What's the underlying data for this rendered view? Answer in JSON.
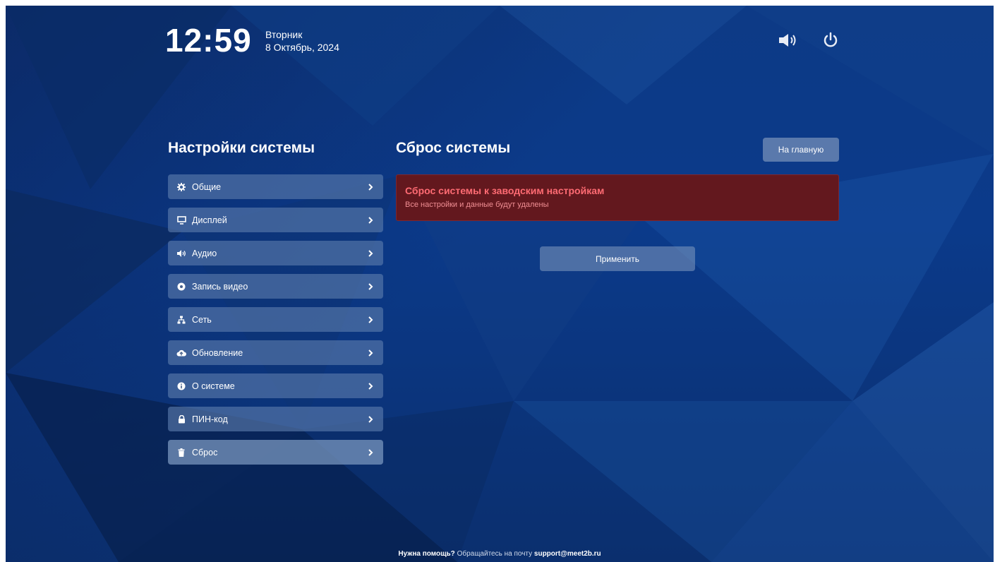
{
  "header": {
    "time": "12:59",
    "weekday": "Вторник",
    "date": "8 Октябрь, 2024",
    "icons": [
      "volume-icon",
      "power-icon"
    ]
  },
  "sidebar": {
    "title": "Настройки системы",
    "items": [
      {
        "label": "Общие",
        "icon": "gear-icon"
      },
      {
        "label": "Дисплей",
        "icon": "monitor-icon"
      },
      {
        "label": "Аудио",
        "icon": "volume-icon"
      },
      {
        "label": "Запись видео",
        "icon": "record-icon"
      },
      {
        "label": "Сеть",
        "icon": "network-icon"
      },
      {
        "label": "Обновление",
        "icon": "cloud-upload-icon"
      },
      {
        "label": "О системе",
        "icon": "info-icon"
      },
      {
        "label": "ПИН-код",
        "icon": "lock-icon"
      },
      {
        "label": "Сброс",
        "icon": "trash-icon"
      }
    ],
    "active_index": 8
  },
  "main": {
    "title": "Сброс системы",
    "home_label": "На главную",
    "warning": {
      "title": "Сброс системы к заводским настройкам",
      "text": "Все настройки и данные будут удалены"
    },
    "apply_label": "Применить"
  },
  "footer": {
    "help_bold": "Нужна помощь?",
    "help_text": "Обращайтесь на почту",
    "email": "support@meet2b.ru"
  },
  "colors": {
    "background": "#0b3a8a",
    "warning_bg": "#63181e",
    "warning_title": "#ff6b73"
  }
}
